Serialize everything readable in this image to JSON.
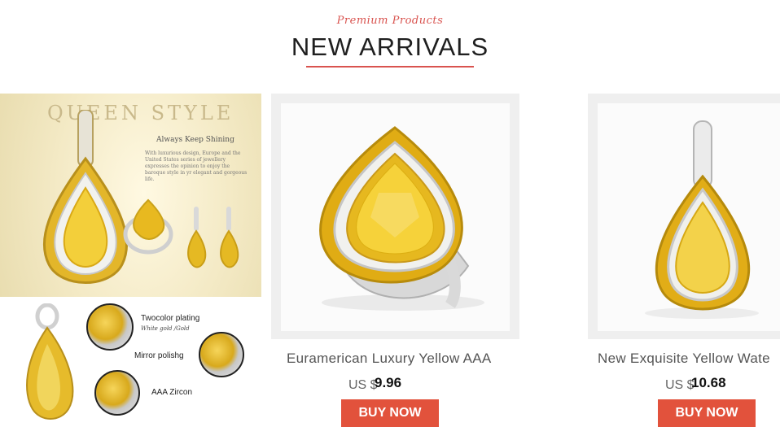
{
  "header": {
    "subtitle": "Premium Products",
    "title": "NEW ARRIVALS"
  },
  "promo": {
    "title": "QUEEN STYLE",
    "tagline": "Always Keep Shining",
    "description": "With luxurious design, Europe and the United States series of jewellery expresses the opinion to enjoy the baroque style in yr elegant and gorgeous life.",
    "features": [
      {
        "label": "Twocolor plating",
        "sub": "White gold /Gold"
      },
      {
        "label": "Mirror polishg",
        "sub": ""
      },
      {
        "label": "AAA Zircon",
        "sub": ""
      }
    ]
  },
  "products": [
    {
      "name": "Euramerican Luxury Yellow AAA",
      "currency": "US $",
      "price": "9.96",
      "button": "BUY NOW"
    },
    {
      "name": "New Exquisite Yellow Wate",
      "currency": "US $",
      "price": "10.68",
      "button": "BUY NOW"
    }
  ],
  "colors": {
    "accent": "#d9534f",
    "button": "#e2523c",
    "gold": "#e7b81c"
  }
}
